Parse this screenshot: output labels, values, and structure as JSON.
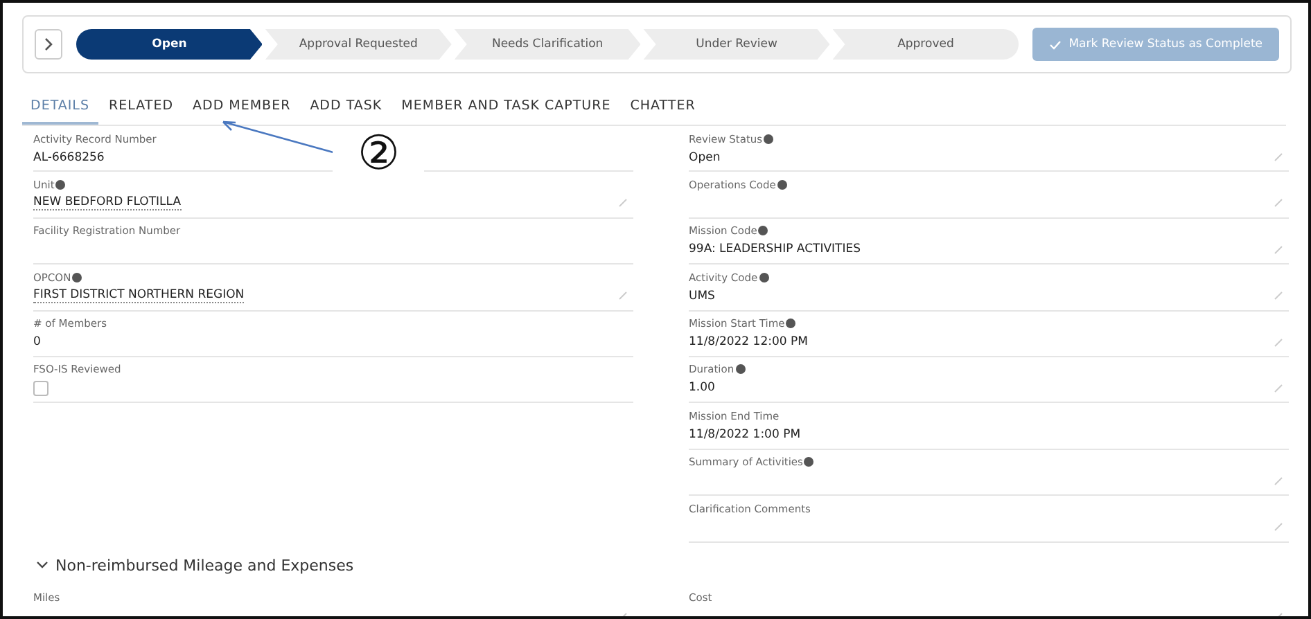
{
  "path": {
    "steps": [
      {
        "label": "Open",
        "selected": true
      },
      {
        "label": "Approval Requested",
        "selected": false
      },
      {
        "label": "Needs Clarification",
        "selected": false
      },
      {
        "label": "Under Review",
        "selected": false
      },
      {
        "label": "Approved",
        "selected": false
      }
    ],
    "complete_button": "Mark Review Status as Complete"
  },
  "tabs": [
    {
      "label": "DETAILS",
      "selected": true
    },
    {
      "label": "RELATED",
      "selected": false
    },
    {
      "label": "ADD MEMBER",
      "selected": false
    },
    {
      "label": "ADD TASK",
      "selected": false
    },
    {
      "label": "MEMBER AND TASK CAPTURE",
      "selected": false
    },
    {
      "label": "CHATTER",
      "selected": false
    }
  ],
  "annotation": {
    "mark": "②"
  },
  "left_fields": [
    {
      "kind": "text",
      "label": "Activity Record Number",
      "value": "AL-6668256",
      "info": false,
      "editable": false
    },
    {
      "kind": "text",
      "label": "Unit",
      "value": "NEW BEDFORD FLOTILLA",
      "info": true,
      "editable": true
    },
    {
      "kind": "text",
      "label": "Facility Registration Number",
      "info": false,
      "editable": false
    },
    {
      "kind": "text",
      "label": "OPCON",
      "value": "FIRST DISTRICT NORTHERN REGION",
      "info": true,
      "editable": true
    },
    {
      "kind": "text",
      "label": "# of Members",
      "value": "0",
      "info": false,
      "editable": false
    },
    {
      "kind": "checkbox",
      "label": "FSO-IS Reviewed",
      "checked": false,
      "info": false,
      "editable": false
    }
  ],
  "right_fields": [
    {
      "kind": "text",
      "label": "Review Status",
      "value": "Open",
      "info": true,
      "editable": true
    },
    {
      "kind": "text",
      "label": "Operations Code",
      "info": true,
      "editable": true
    },
    {
      "kind": "text",
      "label": "Mission Code",
      "value": "99A: LEADERSHIP ACTIVITIES",
      "info": true,
      "editable": true
    },
    {
      "kind": "text",
      "label": "Activity Code",
      "value": "UMS",
      "info": true,
      "editable": true
    },
    {
      "kind": "text",
      "label": "Mission Start Time",
      "value": "11/8/2022 12:00 PM",
      "info": true,
      "editable": true
    },
    {
      "kind": "text",
      "label": "Duration",
      "value": "1.00",
      "info": true,
      "editable": true
    },
    {
      "kind": "text",
      "label": "Mission End Time",
      "value": "11/8/2022 1:00 PM",
      "info": false,
      "editable": false
    },
    {
      "kind": "text",
      "label": "Summary of Activities",
      "info": true,
      "editable": true
    },
    {
      "kind": "text",
      "label": "Clarification Comments",
      "info": false,
      "editable": true
    }
  ],
  "section": {
    "title": "Non-reimbursed Mileage and Expenses",
    "expanded": true,
    "left_fields": [
      {
        "label": "Miles",
        "info": false,
        "editable": true
      }
    ],
    "right_fields": [
      {
        "label": "Cost",
        "info": false,
        "editable": true
      }
    ]
  }
}
